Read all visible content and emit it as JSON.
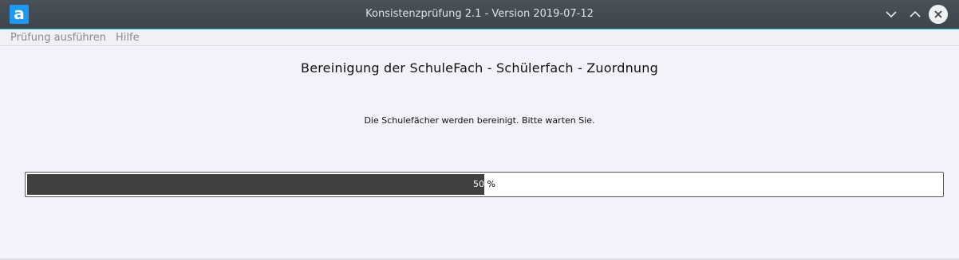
{
  "window": {
    "title": "Konsistenzprüfung 2.1 - Version 2019-07-12",
    "app_icon_letter": "a",
    "accent_color": "#1d99f3"
  },
  "menubar": {
    "items": [
      {
        "label": "Prüfung ausführen"
      },
      {
        "label": "Hilfe"
      }
    ]
  },
  "main": {
    "heading": "Bereinigung der SchuleFach - Schülerfach - Zuordnung",
    "message": "Die Schulefächer werden bereinigt. Bitte warten Sie."
  },
  "progress": {
    "value_percent": 50,
    "value_text": "50",
    "unit_text": " %",
    "fill_color": "#404040"
  }
}
